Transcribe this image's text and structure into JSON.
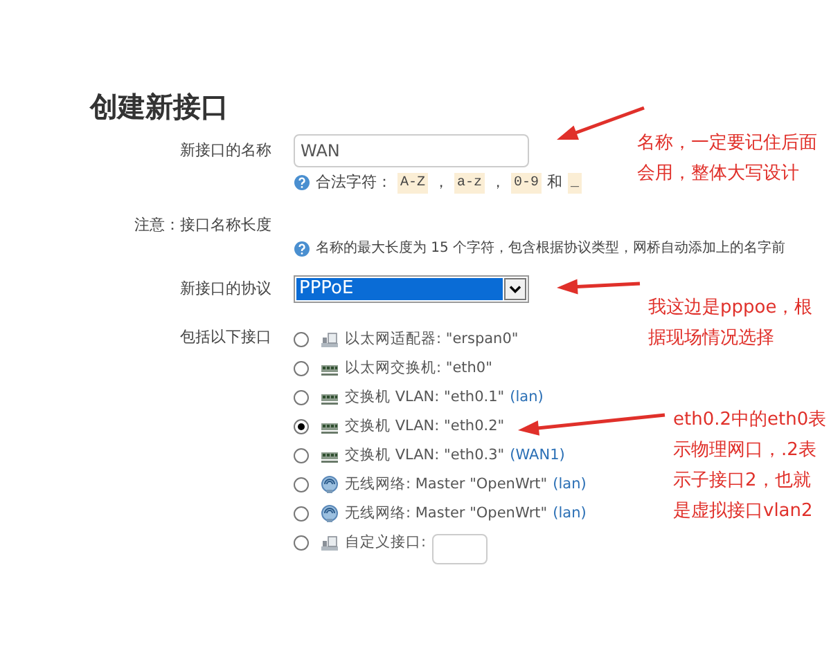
{
  "title": "创建新接口",
  "name_field": {
    "label": "新接口的名称",
    "value": "WAN",
    "hint": [
      {
        "kind": "text",
        "text": "合法字符："
      },
      {
        "kind": "code",
        "text": "A-Z"
      },
      {
        "kind": "text",
        "text": "，"
      },
      {
        "kind": "code",
        "text": "a-z"
      },
      {
        "kind": "text",
        "text": "，"
      },
      {
        "kind": "code",
        "text": "0-9"
      },
      {
        "kind": "text",
        "text": "和"
      },
      {
        "kind": "code",
        "text": "_"
      }
    ]
  },
  "note": {
    "label": "注意：接口名称长度",
    "hint": "名称的最大长度为 15 个字符，包含根据协议类型，网桥自动添加上的名字前"
  },
  "protocol": {
    "label": "新接口的协议",
    "value": "PPPoE"
  },
  "interfaces": {
    "label": "包括以下接口",
    "items": [
      {
        "kind": "adapter",
        "text": "以太网适配器: \"erspan0\"",
        "selected": false
      },
      {
        "kind": "switch",
        "text": "以太网交换机: \"eth0\"",
        "selected": false
      },
      {
        "kind": "switch",
        "text": "交换机 VLAN: \"eth0.1\"",
        "network": "(lan)",
        "selected": false
      },
      {
        "kind": "switch",
        "text": "交换机 VLAN: \"eth0.2\"",
        "selected": true
      },
      {
        "kind": "switch",
        "text": "交换机 VLAN: \"eth0.3\"",
        "network": "(WAN1)",
        "selected": false
      },
      {
        "kind": "wireless",
        "text": "无线网络: Master \"OpenWrt\"",
        "network": "(lan)",
        "selected": false
      },
      {
        "kind": "wireless",
        "text": "无线网络: Master \"OpenWrt\"",
        "network": "(lan)",
        "selected": false
      },
      {
        "kind": "custom",
        "text": "自定义接口:",
        "selected": false
      }
    ]
  },
  "annotations": [
    {
      "lines": [
        "名称，一定要记住后面",
        "会用，整体大写设计"
      ]
    },
    {
      "lines": [
        "我这边是pppoe，根",
        "据现场情况选择"
      ]
    },
    {
      "lines": [
        "eth0.2中的eth0表",
        "示物理网口，.2表",
        "示子接口2，也就",
        "是虚拟接口vlan2"
      ]
    }
  ]
}
